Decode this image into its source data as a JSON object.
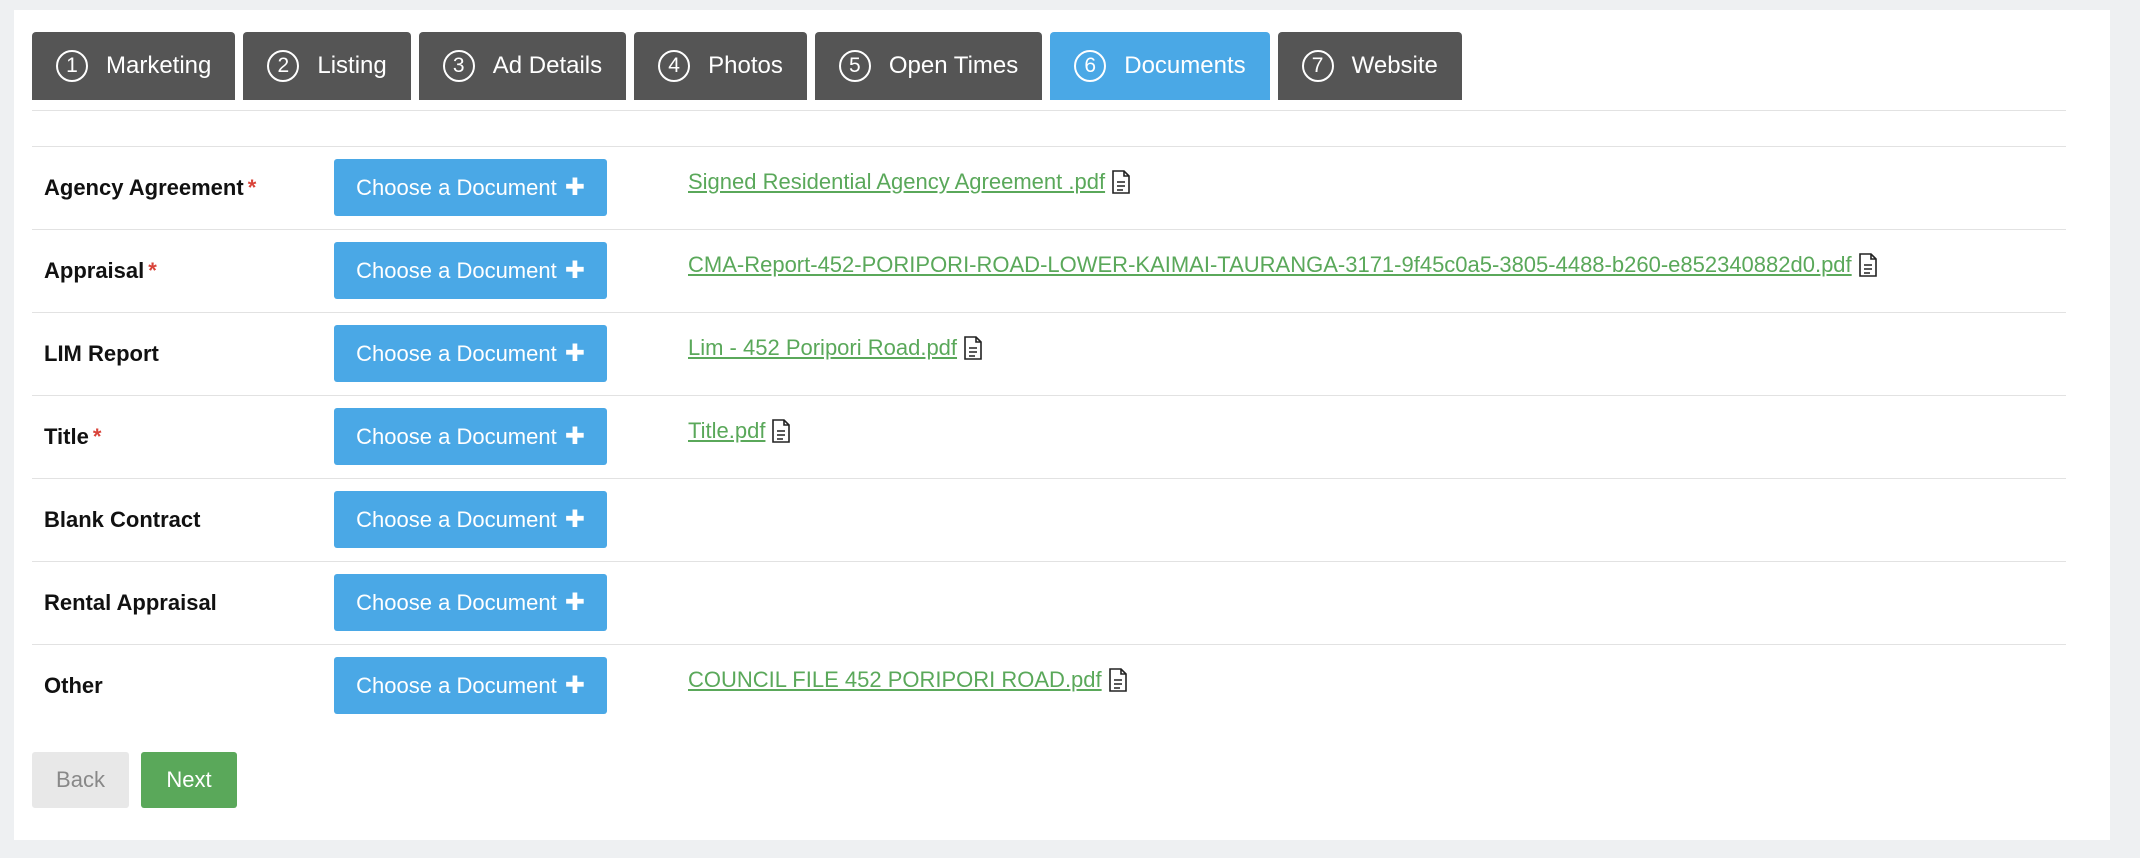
{
  "tabs": [
    {
      "number": "1",
      "label": "Marketing",
      "active": false
    },
    {
      "number": "2",
      "label": "Listing",
      "active": false
    },
    {
      "number": "3",
      "label": "Ad Details",
      "active": false
    },
    {
      "number": "4",
      "label": "Photos",
      "active": false
    },
    {
      "number": "5",
      "label": "Open Times",
      "active": false
    },
    {
      "number": "6",
      "label": "Documents",
      "active": true
    },
    {
      "number": "7",
      "label": "Website",
      "active": false
    }
  ],
  "documents": [
    {
      "label": "Agency Agreement",
      "required": true,
      "button": "Choose a Document",
      "file": "Signed Residential Agency Agreement .pdf"
    },
    {
      "label": "Appraisal",
      "required": true,
      "button": "Choose a Document",
      "file": "CMA-Report-452-PORIPORI-ROAD-LOWER-KAIMAI-TAURANGA-3171-9f45c0a5-3805-4488-b260-e852340882d0.pdf"
    },
    {
      "label": "LIM Report",
      "required": false,
      "button": "Choose a Document",
      "file": "Lim - 452 Poripori Road.pdf"
    },
    {
      "label": "Title",
      "required": true,
      "button": "Choose a Document",
      "file": "Title.pdf"
    },
    {
      "label": "Blank Contract",
      "required": false,
      "button": "Choose a Document",
      "file": ""
    },
    {
      "label": "Rental Appraisal",
      "required": false,
      "button": "Choose a Document",
      "file": ""
    },
    {
      "label": "Other",
      "required": false,
      "button": "Choose a Document",
      "file": "COUNCIL FILE 452 PORIPORI ROAD.pdf"
    }
  ],
  "required_marker": "*",
  "plus_icon": "plus-icon",
  "file_icon": "document-icon",
  "actions": {
    "back": "Back",
    "next": "Next"
  },
  "colors": {
    "active_tab": "#4aa8e6",
    "tab": "#555555",
    "link": "#5aa85a",
    "required": "#d9443a",
    "next": "#5aa85a"
  }
}
